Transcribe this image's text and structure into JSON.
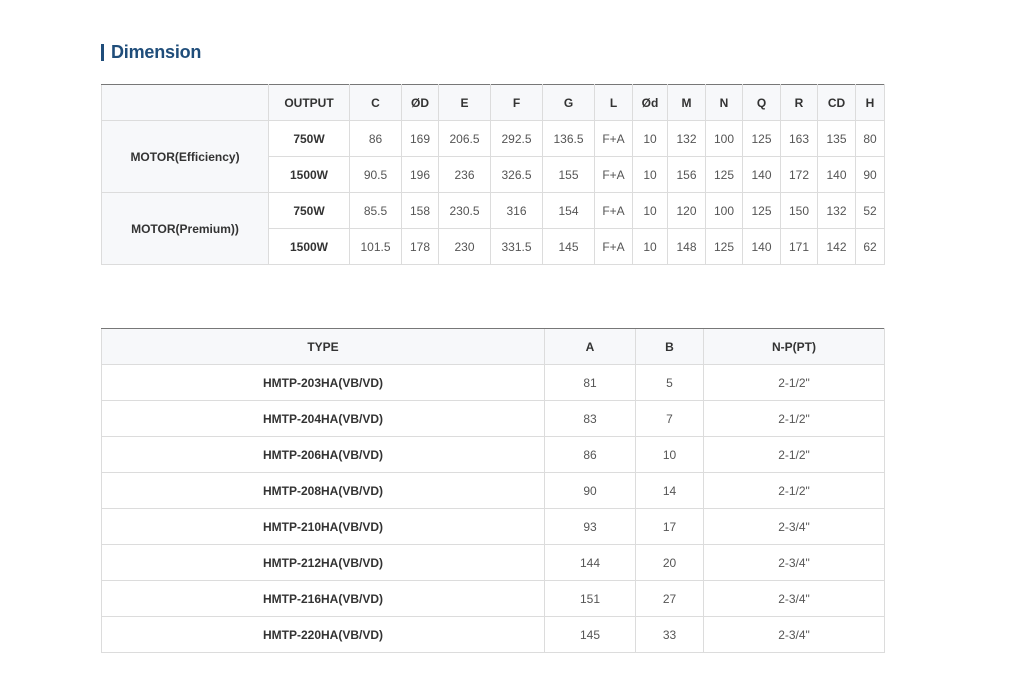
{
  "section": {
    "title": "Dimension"
  },
  "dimension_table": {
    "headers": [
      "OUTPUT",
      "C",
      "ØD",
      "E",
      "F",
      "G",
      "L",
      "Ød",
      "M",
      "N",
      "Q",
      "R",
      "CD",
      "H"
    ],
    "groups": [
      {
        "label": "MOTOR(Efficiency)",
        "rows": [
          {
            "output": "750W",
            "values": [
              "86",
              "169",
              "206.5",
              "292.5",
              "136.5",
              "F+A",
              "10",
              "132",
              "100",
              "125",
              "163",
              "135",
              "80"
            ]
          },
          {
            "output": "1500W",
            "values": [
              "90.5",
              "196",
              "236",
              "326.5",
              "155",
              "F+A",
              "10",
              "156",
              "125",
              "140",
              "172",
              "140",
              "90"
            ]
          }
        ]
      },
      {
        "label": "MOTOR(Premium))",
        "rows": [
          {
            "output": "750W",
            "values": [
              "85.5",
              "158",
              "230.5",
              "316",
              "154",
              "F+A",
              "10",
              "120",
              "100",
              "125",
              "150",
              "132",
              "52"
            ]
          },
          {
            "output": "1500W",
            "values": [
              "101.5",
              "178",
              "230",
              "331.5",
              "145",
              "F+A",
              "10",
              "148",
              "125",
              "140",
              "171",
              "142",
              "62"
            ]
          }
        ]
      }
    ]
  },
  "type_table": {
    "headers": [
      "TYPE",
      "A",
      "B",
      "N-P(PT)"
    ],
    "rows": [
      [
        "HMTP-203HA(VB/VD)",
        "81",
        "5",
        "2-1/2\""
      ],
      [
        "HMTP-204HA(VB/VD)",
        "83",
        "7",
        "2-1/2\""
      ],
      [
        "HMTP-206HA(VB/VD)",
        "86",
        "10",
        "2-1/2\""
      ],
      [
        "HMTP-208HA(VB/VD)",
        "90",
        "14",
        "2-1/2\""
      ],
      [
        "HMTP-210HA(VB/VD)",
        "93",
        "17",
        "2-3/4\""
      ],
      [
        "HMTP-212HA(VB/VD)",
        "144",
        "20",
        "2-3/4\""
      ],
      [
        "HMTP-216HA(VB/VD)",
        "151",
        "27",
        "2-3/4\""
      ],
      [
        "HMTP-220HA(VB/VD)",
        "145",
        "33",
        "2-3/4\""
      ]
    ]
  }
}
